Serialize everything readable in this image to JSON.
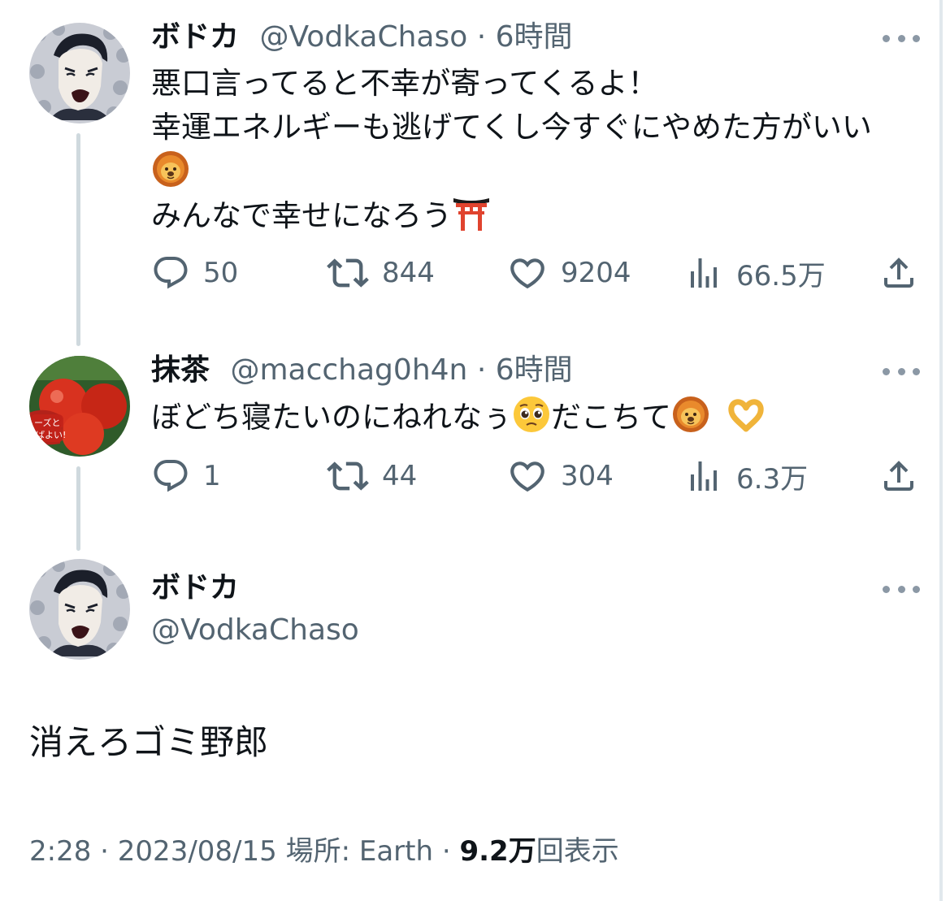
{
  "tweets": [
    {
      "name": "ボドカ",
      "handle": "@VodkaChaso",
      "separator": "·",
      "time": "6時間",
      "lines": [
        "悪口言ってると不幸が寄ってくるよ！",
        "幸運エネルギーも逃げてくし今すぐにやめた方がいい",
        "",
        "みんなで幸せになろう"
      ],
      "actions": {
        "replies": "50",
        "retweets": "844",
        "likes": "9204",
        "views": "66.5万"
      }
    },
    {
      "name": "抹茶",
      "handle": "@macchag0h4n",
      "separator": "·",
      "time": "6時間",
      "line_a": "ぼどち寝たいのにねれなぅ",
      "line_b": "だこちて",
      "actions": {
        "replies": "1",
        "retweets": "44",
        "likes": "304",
        "views": "6.3万"
      }
    }
  ],
  "main": {
    "name": "ボドカ",
    "handle": "@VodkaChaso",
    "text": "消えろゴミ野郎",
    "meta": {
      "time": "2:28",
      "sep1": "·",
      "date": "2023/08/15",
      "location_label": "場所:",
      "location": "Earth",
      "sep2": "·",
      "views_count": "9.2万",
      "views_label": "回表示"
    }
  },
  "icons": [
    "lion-emoji-icon",
    "torii-emoji-icon",
    "pleading-face-emoji-icon",
    "heart-hands-emoji-icon",
    "reply-icon",
    "retweet-icon",
    "like-icon",
    "views-icon",
    "share-icon",
    "more-icon"
  ],
  "colors": {
    "text": "#0f1419",
    "secondary": "#536471",
    "thread_line": "#cfd9de"
  }
}
